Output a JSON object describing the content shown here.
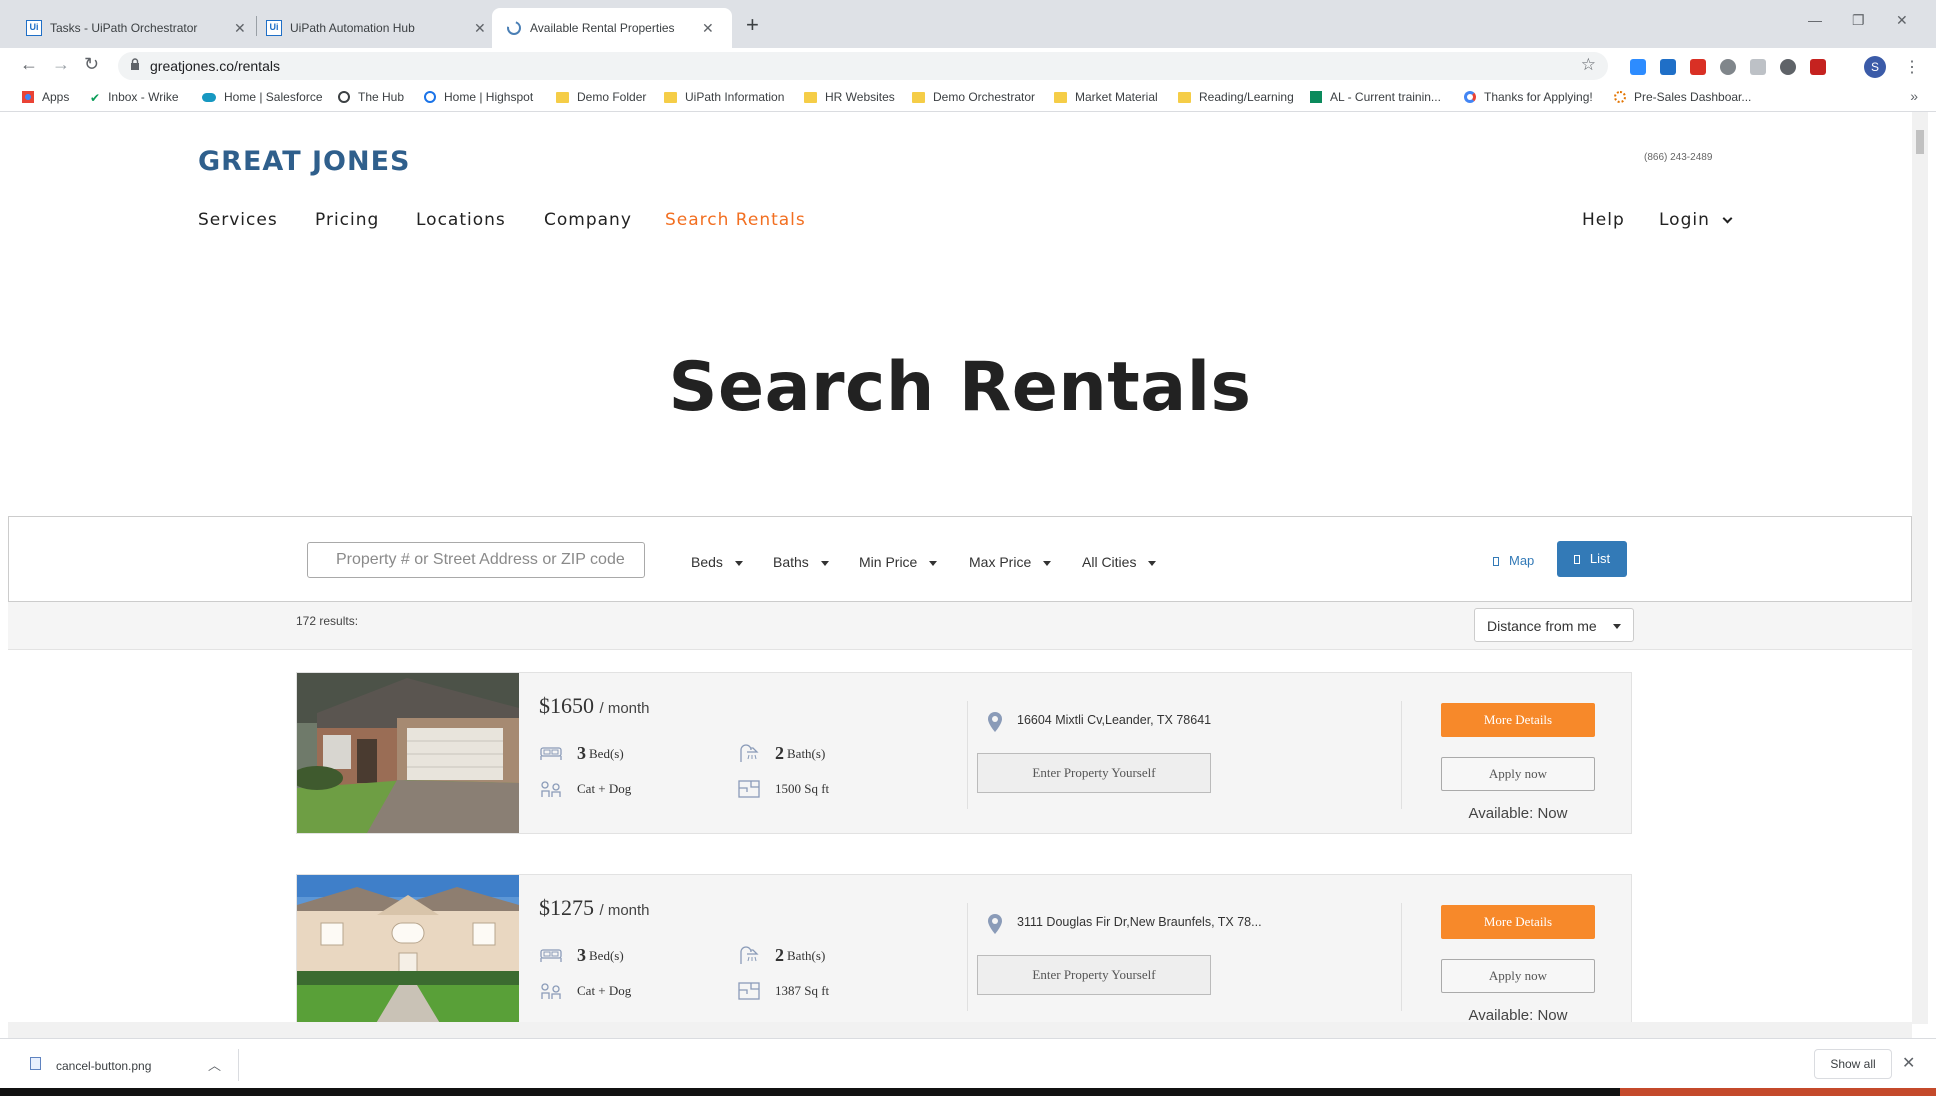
{
  "browser": {
    "tabs": [
      {
        "label": "Tasks - UiPath Orchestrator"
      },
      {
        "label": "UiPath Automation Hub"
      },
      {
        "label": "Available Rental Properties"
      }
    ],
    "url": "greatjones.co/rentals",
    "avatar_letter": "S",
    "bookmarks": [
      {
        "label": "Apps"
      },
      {
        "label": "Inbox - Wrike"
      },
      {
        "label": "Home | Salesforce"
      },
      {
        "label": "The Hub"
      },
      {
        "label": "Home | Highspot"
      },
      {
        "label": "Demo Folder"
      },
      {
        "label": "UiPath Information"
      },
      {
        "label": "HR Websites"
      },
      {
        "label": "Demo Orchestrator"
      },
      {
        "label": "Market Material"
      },
      {
        "label": "Reading/Learning"
      },
      {
        "label": "AL - Current trainin..."
      },
      {
        "label": "Thanks for Applying!"
      },
      {
        "label": "Pre-Sales Dashboar..."
      }
    ]
  },
  "site": {
    "logo": "GREAT JONES",
    "phone": "(866) 243-2489",
    "nav": {
      "services": "Services",
      "pricing": "Pricing",
      "locations": "Locations",
      "company": "Company",
      "search_rentals": "Search Rentals",
      "help": "Help",
      "login": "Login"
    },
    "hero_title": "Search Rentals"
  },
  "filters": {
    "search_placeholder": "Property # or Street Address or ZIP code",
    "beds": "Beds",
    "baths": "Baths",
    "min_price": "Min Price",
    "max_price": "Max Price",
    "cities": "All Cities",
    "map": "Map",
    "list": "List"
  },
  "results": {
    "count": "172 results:",
    "sort": "Distance from me"
  },
  "listings": [
    {
      "price": "$1650",
      "per": "/ month",
      "beds": "3",
      "beds_label": "Bed(s)",
      "baths": "2",
      "baths_label": "Bath(s)",
      "pets": "Cat + Dog",
      "sqft": "1500 Sq ft",
      "address": "16604 Mixtli Cv,Leander, TX 78641",
      "enter_label": "Enter Property Yourself",
      "more_label": "More Details",
      "apply_label": "Apply now",
      "available": "Available: Now"
    },
    {
      "price": "$1275",
      "per": "/ month",
      "beds": "3",
      "beds_label": "Bed(s)",
      "baths": "2",
      "baths_label": "Bath(s)",
      "pets": "Cat + Dog",
      "sqft": "1387 Sq ft",
      "address": "3111 Douglas Fir Dr,New Braunfels, TX 78...",
      "enter_label": "Enter Property Yourself",
      "more_label": "More Details",
      "apply_label": "Apply now",
      "available": "Available: Now"
    }
  ],
  "download": {
    "filename": "cancel-button.png",
    "show_all": "Show all"
  },
  "colors": {
    "accent_orange": "#f26f21",
    "button_orange": "#f7892a",
    "list_blue": "#337ab7",
    "logo_blue": "#2f5f8c"
  }
}
